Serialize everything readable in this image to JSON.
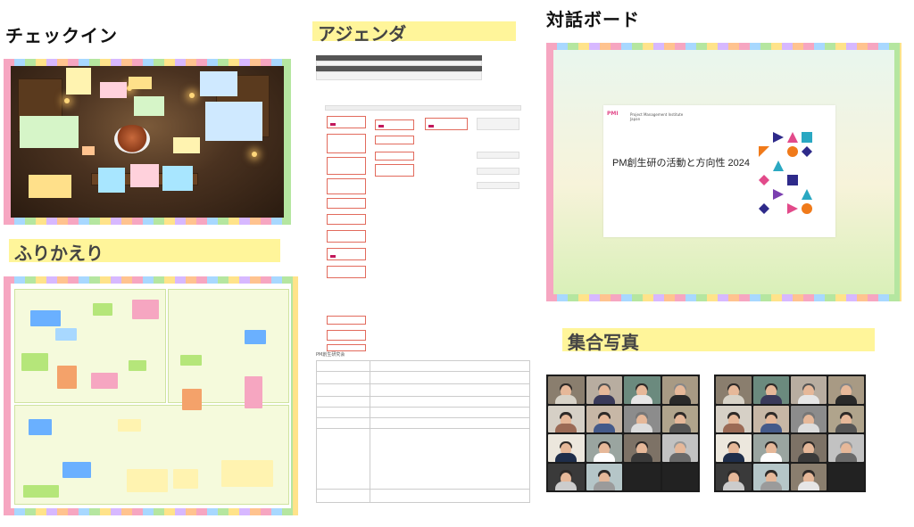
{
  "sections": {
    "checkin_title": "チェックイン",
    "agenda_title": "アジェンダ",
    "dialogue_title": "対話ボード",
    "reflection_title": "ふりかえり",
    "group_photo_title": "集合写真"
  },
  "dialogue_slide": {
    "title": "PM創生研の活動と方向性 2024",
    "logo_lines": [
      "PMI",
      "Project Management Institute Japan"
    ]
  },
  "agenda": {
    "table_label": "PM創生研究会"
  },
  "colors": {
    "highlight": "#fff59a",
    "kanban_border": "#e26b5d",
    "reflection_bg": "#f5fadc",
    "zoom_bg": "#1c1c1c"
  }
}
